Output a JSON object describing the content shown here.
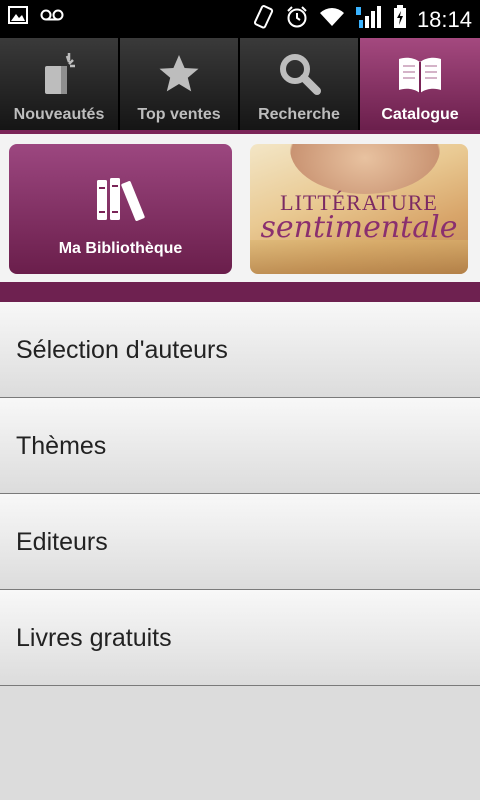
{
  "status_bar": {
    "time": "18:14",
    "icons": [
      "gallery-icon",
      "voicemail-icon",
      "rotate-icon",
      "alarm-icon",
      "wifi-icon",
      "signal-icon",
      "battery-charging-icon"
    ]
  },
  "tabs": [
    {
      "label": "Nouveautés",
      "icon": "new-books-icon",
      "active": false
    },
    {
      "label": "Top ventes",
      "icon": "star-icon",
      "active": false
    },
    {
      "label": "Recherche",
      "icon": "search-icon",
      "active": false
    },
    {
      "label": "Catalogue",
      "icon": "open-book-icon",
      "active": true
    }
  ],
  "banners": {
    "library_label": "Ma Bibliothèque",
    "promo_line1": "LITTÉRATURE",
    "promo_line2": "sentimentale"
  },
  "list": {
    "items": [
      "Sélection d'auteurs",
      "Thèmes",
      "Editeurs",
      "Livres gratuits"
    ]
  },
  "colors": {
    "accent": "#7a2457",
    "accent_light": "#a4497f",
    "tab_dark": "#2b2b2b"
  }
}
